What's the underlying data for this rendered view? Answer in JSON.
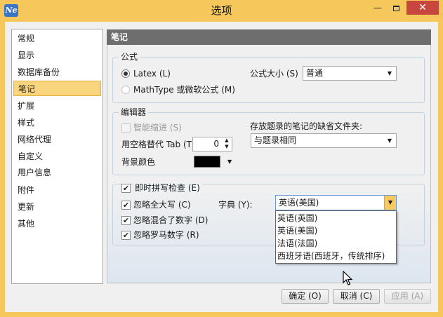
{
  "window": {
    "title": "选项",
    "app_icon_text": "Ne",
    "minimize_glyph": "—",
    "close_glyph": "✕",
    "accent_color": "#f6c75b"
  },
  "sidebar": {
    "items": [
      {
        "label": "常规"
      },
      {
        "label": "显示"
      },
      {
        "label": "数据库备份"
      },
      {
        "label": "笔记",
        "selected": true
      },
      {
        "label": "扩展"
      },
      {
        "label": "样式"
      },
      {
        "label": "网络代理"
      },
      {
        "label": "自定义"
      },
      {
        "label": "用户信息"
      },
      {
        "label": "附件"
      },
      {
        "label": "更新"
      },
      {
        "label": "其他"
      }
    ]
  },
  "panel": {
    "header": "笔记",
    "formula": {
      "legend": "公式",
      "latex_label": "Latex (L)",
      "mathtype_label": "MathType 或微软公式 (M)",
      "size_label": "公式大小 (S)",
      "size_value": "普通"
    },
    "editor": {
      "legend": "编辑器",
      "smart_indent_label": "智能缩进 (S)",
      "tab_spaces_label": "用空格替代 Tab (T",
      "tab_spaces_value": "0",
      "bg_color_label": "背景颜色",
      "bg_color_value": "#000000",
      "default_folder_label": "存放题录的笔记的缺省文件夹:",
      "default_folder_value": "与题录相同"
    },
    "spellcheck": {
      "enable_label": "即时拼写检查 (E)",
      "ignore_upper_label": "忽略全大写 (C)",
      "ignore_mixed_label": "忽略混合了数字 (D)",
      "ignore_roman_label": "忽略罗马数字 (R)",
      "dict_label": "字典 (Y):",
      "dict_value": "英语(美国)",
      "dict_options": [
        "英语(英国)",
        "英语(美国)",
        "法语(法国)",
        "西班牙语(西班牙，传统排序)"
      ]
    }
  },
  "buttons": {
    "ok": "确定 (O)",
    "cancel": "取消 (C)",
    "apply": "应用 (A)"
  }
}
